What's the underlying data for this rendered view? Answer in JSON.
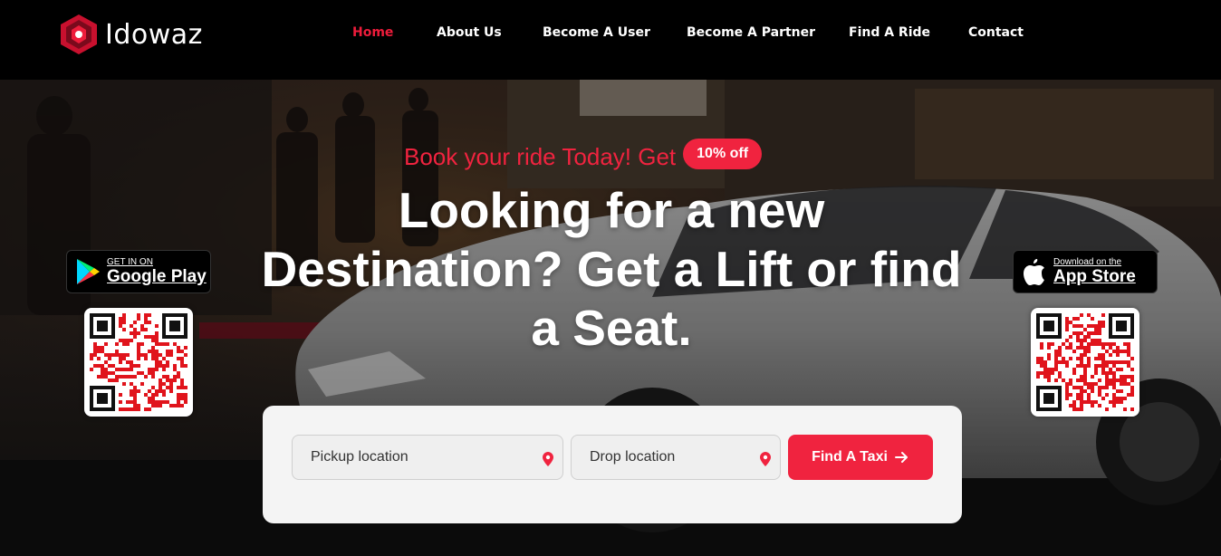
{
  "brand": {
    "name": "Idowaz",
    "accent": "#ee1c3b"
  },
  "nav": {
    "items": [
      {
        "label": "Home",
        "active": true
      },
      {
        "label": "About Us"
      },
      {
        "label": "Become A User"
      },
      {
        "label": "Become A Partner"
      },
      {
        "label": "Find A Ride"
      },
      {
        "label": "Contact"
      }
    ]
  },
  "hero": {
    "promo_text": "Book your ride Today! Get",
    "promo_badge": "10% off",
    "headline": "Looking for a new Destination? Get a Lift or find a Seat."
  },
  "stores": {
    "google": {
      "small": "GET IN ON",
      "big": "Google Play",
      "icon": "google-play-icon"
    },
    "apple": {
      "small": "Download on the",
      "big": "App Store",
      "icon": "apple-icon"
    }
  },
  "search": {
    "pickup_placeholder": "Pickup location",
    "drop_placeholder": "Drop location",
    "button_label": "Find A Taxi"
  }
}
